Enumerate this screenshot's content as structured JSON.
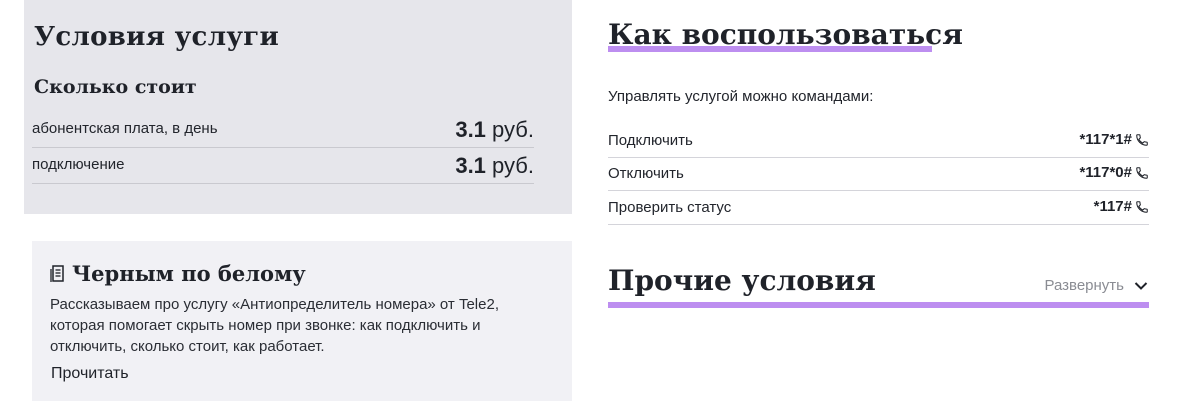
{
  "conditions": {
    "title": "Условия услуги",
    "subtitle": "Сколько стоит",
    "rows": [
      {
        "label": "абонентская плата, в день",
        "amount": "3.1",
        "unit": "руб."
      },
      {
        "label": "подключение",
        "amount": "3.1",
        "unit": "руб."
      }
    ]
  },
  "article": {
    "icon": "document-icon",
    "title": "Черным по белому",
    "text": "Рассказываем про услугу «Антиопределитель номера» от Tele2, которая помогает скрыть номер при звонке: как подключить и отключить, сколько стоит, как работает.",
    "link": "Прочитать"
  },
  "howto": {
    "title": "Как воспользоваться",
    "intro": "Управлять услугой можно командами:",
    "commands": [
      {
        "label": "Подключить",
        "code": "*117*1#",
        "icon": "phone-icon"
      },
      {
        "label": "Отключить",
        "code": "*117*0#",
        "icon": "phone-icon"
      },
      {
        "label": "Проверить статус",
        "code": "*117#",
        "icon": "phone-icon"
      }
    ]
  },
  "other": {
    "title": "Прочие условия",
    "expand_label": "Развернуть",
    "expand_icon": "chevron-down-icon"
  },
  "colors": {
    "accent": "#bd8ef0",
    "panel": "#e6e6eb",
    "card": "#f1f1f5"
  }
}
